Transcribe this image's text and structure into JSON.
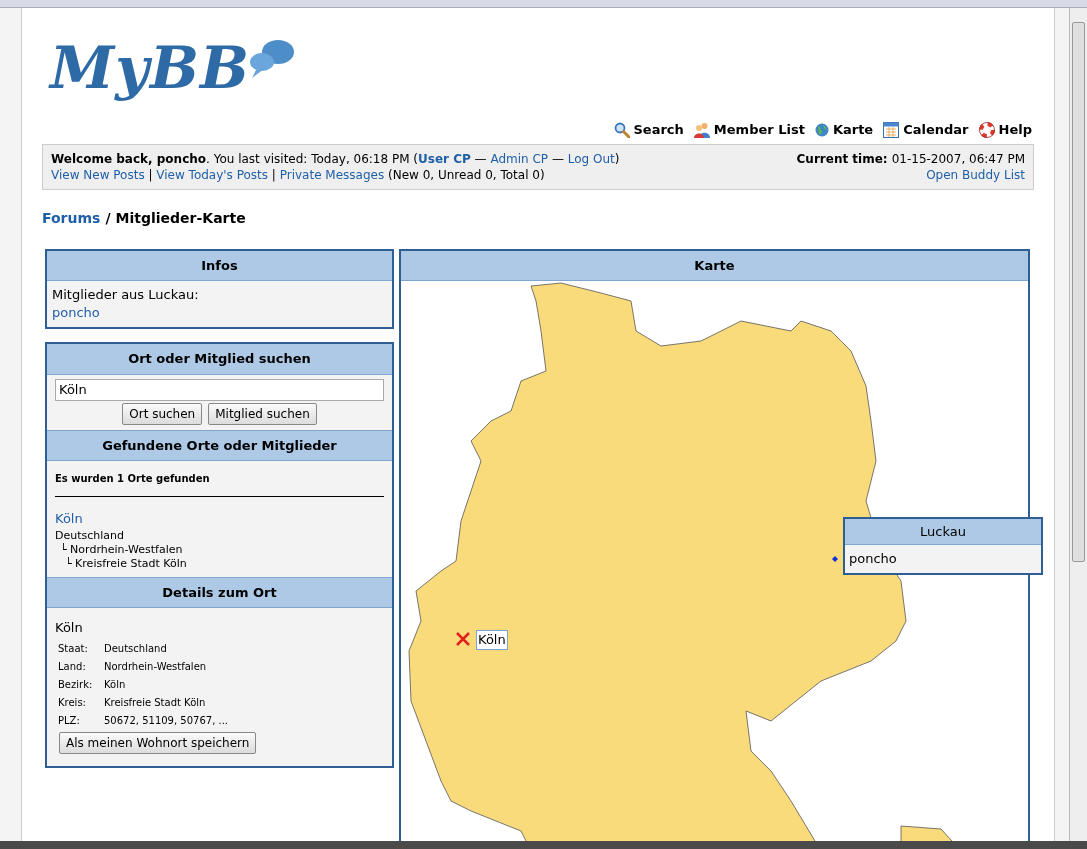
{
  "logo": {
    "text": "MyBB"
  },
  "nav": [
    {
      "label": "Search"
    },
    {
      "label": "Member List"
    },
    {
      "label": "Karte"
    },
    {
      "label": "Calendar"
    },
    {
      "label": "Help"
    }
  ],
  "welcome": {
    "line1": [
      {
        "kind": "strong",
        "text": "Welcome back, poncho"
      },
      {
        "kind": "text",
        "text": ". You last visited: Today, 06:18 PM ("
      },
      {
        "kind": "strong-link",
        "text": "User CP"
      },
      {
        "kind": "text",
        "text": " — "
      },
      {
        "kind": "link",
        "text": "Admin CP"
      },
      {
        "kind": "text",
        "text": " — "
      },
      {
        "kind": "link",
        "text": "Log Out"
      },
      {
        "kind": "text",
        "text": ")"
      }
    ],
    "line2": [
      {
        "kind": "link",
        "text": "View New Posts"
      },
      {
        "kind": "text",
        "text": " | "
      },
      {
        "kind": "link",
        "text": "View Today's Posts"
      },
      {
        "kind": "text",
        "text": " | "
      },
      {
        "kind": "link",
        "text": "Private Messages"
      },
      {
        "kind": "text",
        "text": " (New 0, Unread 0, Total 0)"
      }
    ],
    "time_label": "Current time:",
    "time_value": "01-15-2007, 06:47 PM",
    "buddy_link": "Open Buddy List"
  },
  "breadcrumb": {
    "link": "Forums",
    "separator": "/",
    "current": "Mitglieder-Karte"
  },
  "infos": {
    "title": "Infos",
    "text": "Mitglieder aus Luckau:",
    "member": "poncho"
  },
  "search": {
    "title": "Ort oder Mitglied suchen",
    "value": "Köln",
    "buttons": [
      "Ort suchen",
      "Mitglied suchen"
    ]
  },
  "results": {
    "title": "Gefundene Orte oder Mitglieder",
    "summary": "Es wurden 1 Orte gefunden",
    "place": "Köln",
    "tree": {
      "label": "Deutschland",
      "children": [
        {
          "label": "└ Nordrhein-Westfalen",
          "children": [
            {
              "label": "└ Kreisfreie Stadt Köln"
            }
          ]
        }
      ]
    }
  },
  "details": {
    "title": "Details zum Ort",
    "place": "Köln",
    "rows": [
      {
        "label": "Staat:",
        "value": "Deutschland"
      },
      {
        "label": "Land:",
        "value": "Nordrhein-Westfalen"
      },
      {
        "label": "Bezirk:",
        "value": "Köln"
      },
      {
        "label": "Kreis:",
        "value": "Kreisfreie Stadt Köln"
      },
      {
        "label": "PLZ:",
        "value": "50672, 51109, 50767, ..."
      }
    ],
    "button": "Als meinen Wohnort speichern"
  },
  "map": {
    "title": "Karte",
    "marker_label": "Köln",
    "popup": {
      "title": "Luckau",
      "member": "poncho"
    }
  }
}
